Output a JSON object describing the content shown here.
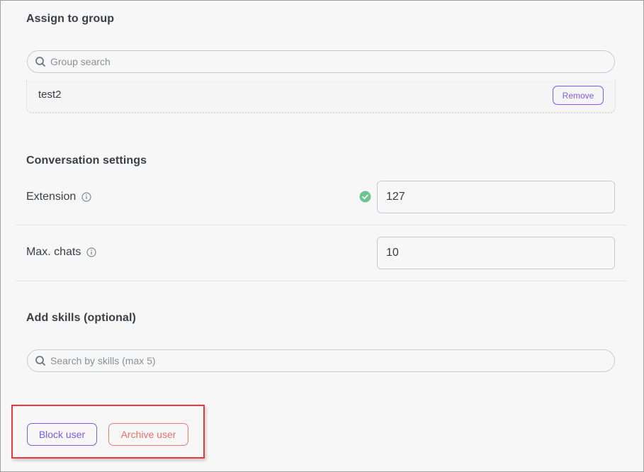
{
  "assign_group": {
    "title": "Assign to group",
    "search_placeholder": "Group search",
    "search_value": "",
    "groups": [
      {
        "name": "test2",
        "remove_label": "Remove"
      }
    ]
  },
  "conversation_settings": {
    "title": "Conversation settings",
    "extension": {
      "label": "Extension",
      "value": "127",
      "status": "valid"
    },
    "max_chats": {
      "label": "Max. chats",
      "value": "10"
    }
  },
  "skills": {
    "title": "Add skills (optional)",
    "search_placeholder": "Search by skills (max 5)",
    "search_value": ""
  },
  "actions": {
    "block_label": "Block user",
    "archive_label": "Archive user"
  },
  "colors": {
    "accent": "#7b5cf0",
    "danger": "#ec6f68",
    "success": "#6cc58c",
    "highlight": "#e8383f"
  }
}
